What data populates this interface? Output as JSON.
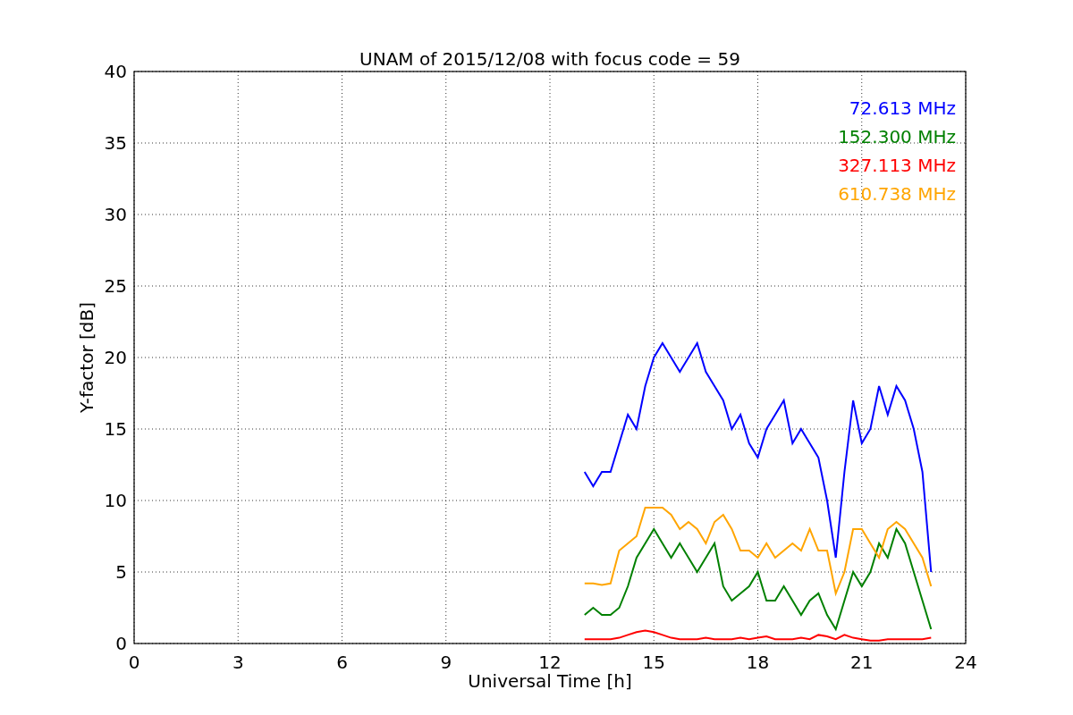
{
  "chart_data": {
    "type": "line",
    "title": "UNAM of 2015/12/08 with focus code = 59",
    "xlabel": "Universal Time [h]",
    "ylabel": "Y-factor [dB]",
    "x": [
      13,
      13.25,
      13.5,
      13.75,
      14,
      14.25,
      14.5,
      14.75,
      15,
      15.25,
      15.5,
      15.75,
      16,
      16.25,
      16.5,
      16.75,
      17,
      17.25,
      17.5,
      17.75,
      18,
      18.25,
      18.5,
      18.75,
      19,
      19.25,
      19.5,
      19.75,
      20,
      20.25,
      20.5,
      20.75,
      21,
      21.25,
      21.5,
      21.75,
      22,
      22.25,
      22.5,
      22.75,
      23
    ],
    "series": [
      {
        "name": "72.613 MHz",
        "color": "#0000ff",
        "values": [
          12,
          11,
          12,
          12,
          14,
          16,
          15,
          18,
          20,
          21,
          20,
          19,
          20,
          21,
          19,
          18,
          17,
          15,
          16,
          14,
          13,
          15,
          16,
          17,
          14,
          15,
          14,
          13,
          10,
          6,
          12,
          17,
          14,
          15,
          18,
          16,
          18,
          17,
          15,
          12,
          5
        ]
      },
      {
        "name": "152.300 MHz",
        "color": "#008000",
        "values": [
          2,
          2.5,
          2,
          2,
          2.5,
          4,
          6,
          7,
          8,
          7,
          6,
          7,
          6,
          5,
          6,
          7,
          4,
          3,
          3.5,
          4,
          5,
          3,
          3,
          4,
          3,
          2,
          3,
          3.5,
          2,
          1,
          3,
          5,
          4,
          5,
          7,
          6,
          8,
          7,
          5,
          3,
          1
        ]
      },
      {
        "name": "327.113 MHz",
        "color": "#ff0000",
        "values": [
          0.3,
          0.3,
          0.3,
          0.3,
          0.4,
          0.6,
          0.8,
          0.9,
          0.8,
          0.6,
          0.4,
          0.3,
          0.3,
          0.3,
          0.4,
          0.3,
          0.3,
          0.3,
          0.4,
          0.3,
          0.4,
          0.5,
          0.3,
          0.3,
          0.3,
          0.4,
          0.3,
          0.6,
          0.5,
          0.3,
          0.6,
          0.4,
          0.3,
          0.2,
          0.2,
          0.3,
          0.3,
          0.3,
          0.3,
          0.3,
          0.4
        ]
      },
      {
        "name": "610.738 MHz",
        "color": "#ffa500",
        "values": [
          4.2,
          4.2,
          4.1,
          4.2,
          6.5,
          7,
          7.5,
          9.5,
          9.5,
          9.5,
          9,
          8,
          8.5,
          8,
          7,
          8.5,
          9,
          8,
          6.5,
          6.5,
          6,
          7,
          6,
          6.5,
          7,
          6.5,
          8,
          6.5,
          6.5,
          3.5,
          5,
          8,
          8,
          7,
          6,
          8,
          8.5,
          8,
          7,
          6,
          4
        ]
      }
    ],
    "grid": true,
    "xlim": [
      0,
      24
    ],
    "ylim": [
      0,
      40
    ],
    "xticks": [
      0,
      3,
      6,
      9,
      12,
      15,
      18,
      21,
      24
    ],
    "yticks": [
      0,
      5,
      10,
      15,
      20,
      25,
      30,
      35,
      40
    ]
  }
}
